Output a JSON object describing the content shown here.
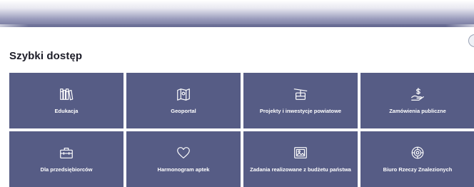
{
  "page": {
    "section_title": "Szybki dostęp"
  },
  "colors": {
    "tile_background": "#565c85",
    "tile_text": "#ffffff",
    "title_text": "#1d1d28"
  },
  "tiles": [
    {
      "label": "Edukacja",
      "icon": "books-icon"
    },
    {
      "label": "Geoportal",
      "icon": "map-icon"
    },
    {
      "label": "Projekty i inwestycje powiatowe",
      "icon": "cable-car-icon"
    },
    {
      "label": "Zamówienia publiczne",
      "icon": "hand-money-icon"
    },
    {
      "label": "Dla przedsiębiorców",
      "icon": "briefcase-icon"
    },
    {
      "label": "Harmonogram aptek",
      "icon": "heart-icon"
    },
    {
      "label": "Zadania realizowane z budżetu państwa",
      "icon": "image-frame-icon"
    },
    {
      "label": "Biuro Rzeczy Znalezionych",
      "icon": "settings-badge-icon"
    }
  ]
}
